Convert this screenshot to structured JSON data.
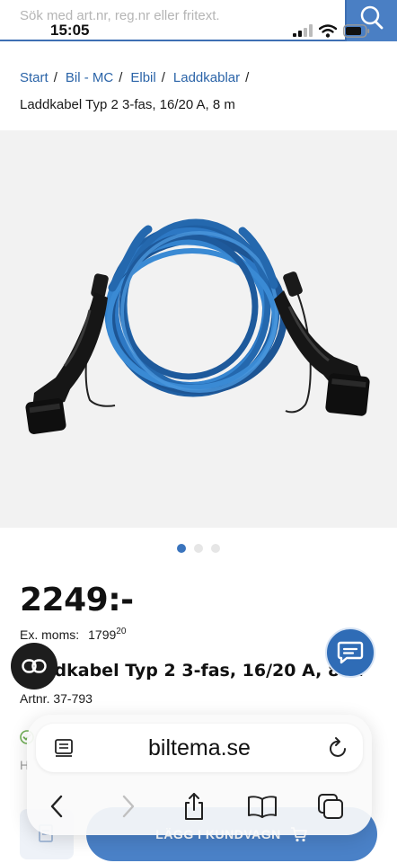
{
  "status_bar": {
    "time": "15:05"
  },
  "search": {
    "placeholder": "Sök med art.nr, reg.nr eller fritext."
  },
  "breadcrumb": {
    "items": [
      "Start",
      "Bil - MC",
      "Elbil",
      "Laddkablar"
    ],
    "separator": "/",
    "current": "Laddkabel Typ 2 3-fas, 16/20 A, 8 m"
  },
  "product": {
    "price": "2249:-",
    "ex_moms_label": "Ex. moms:",
    "ex_moms_value": "1799",
    "ex_moms_cents": "20",
    "title": "Laddkabel Typ 2 3-fas, 16/20 A, 8 m",
    "article_number": "Artnr. 37-793",
    "stock_letter": "H",
    "image_count": 3,
    "active_image": 1
  },
  "actions": {
    "add_to_cart": "LÄGG I KUNDVAGN"
  },
  "browser": {
    "url": "biltema.se"
  },
  "colors": {
    "brand_blue": "#2b64a8",
    "cart_blue": "#4a81c7",
    "price_black": "#111111"
  },
  "icons": {
    "search": "magnifier-icon",
    "compare": "link-icon",
    "chat": "chat-bubble-icon",
    "reader": "reader-icon",
    "reload": "reload-icon",
    "back": "chevron-left-icon",
    "forward": "chevron-right-icon",
    "share": "share-icon",
    "bookmarks": "book-icon",
    "tabs": "tabs-icon"
  }
}
